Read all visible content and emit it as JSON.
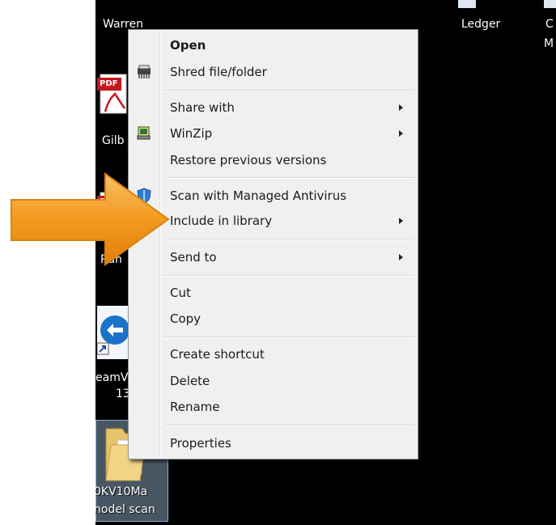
{
  "desktop": {
    "labels": {
      "warren": "Warren",
      "ledger": "Ledger",
      "partial_c": "C",
      "partial_m": "M",
      "gilb": "Gilb",
      "run": "Run",
      "teamviewer": "eamV",
      "teamviewer_num": "13",
      "folder_line1": "0KV10Ma",
      "folder_line2": "nodel scan"
    },
    "pdf_badge": "PDF"
  },
  "context_menu": {
    "items": [
      {
        "label": "Open"
      },
      {
        "label": "Shred file/folder"
      },
      {
        "label": "Share with"
      },
      {
        "label": "WinZip"
      },
      {
        "label": "Restore previous versions"
      },
      {
        "label": "Scan with Managed Antivirus"
      },
      {
        "label": "Include in library"
      },
      {
        "label": "Send to"
      },
      {
        "label": "Cut"
      },
      {
        "label": "Copy"
      },
      {
        "label": "Create shortcut"
      },
      {
        "label": "Delete"
      },
      {
        "label": "Rename"
      },
      {
        "label": "Properties"
      }
    ]
  },
  "colors": {
    "desktop_bg": "#000000",
    "menu_bg": "#f0f0f0",
    "arrow_orange": "#f39a1e"
  }
}
